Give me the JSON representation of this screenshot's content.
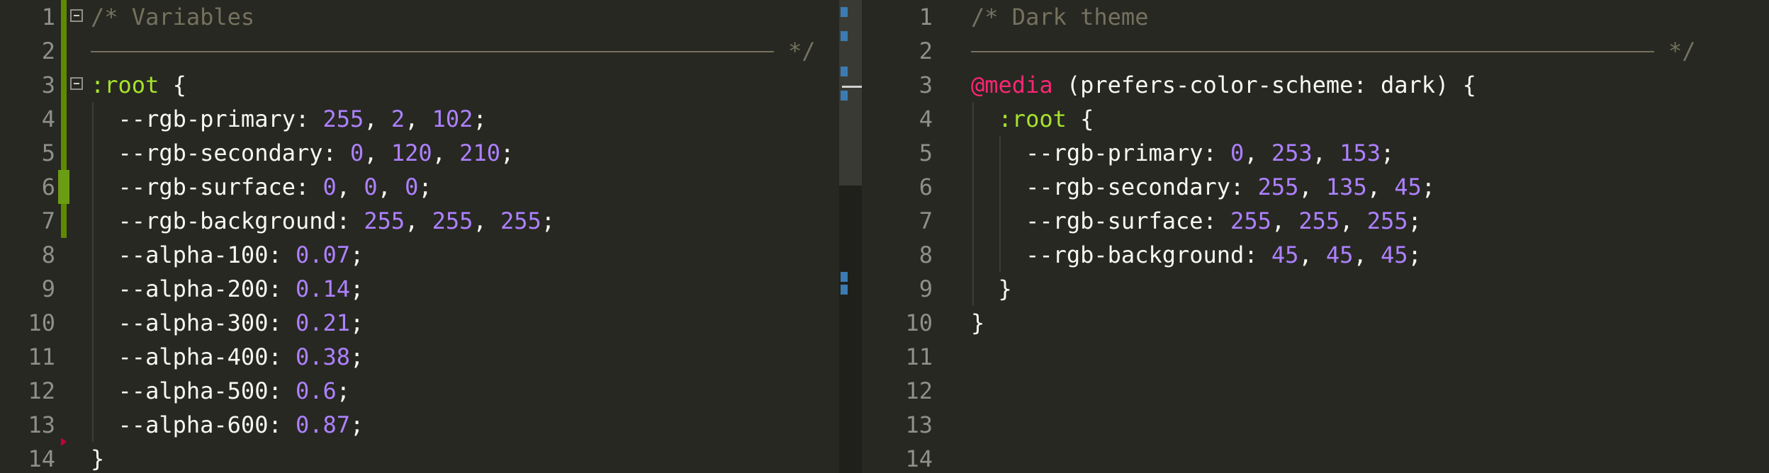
{
  "left_pane": {
    "lines": [
      {
        "n": "1",
        "t": [
          {
            "c": "comment",
            "v": "/* Variables"
          }
        ]
      },
      {
        "n": "2",
        "t": [
          {
            "c": "comment",
            "v": "*/"
          }
        ]
      },
      {
        "n": "3",
        "t": [
          {
            "c": "selector",
            "v": ":root"
          },
          {
            "c": "plain",
            "v": " {"
          }
        ]
      },
      {
        "n": "4",
        "t": [
          {
            "c": "plain",
            "v": "  --rgb-primary: "
          },
          {
            "c": "num",
            "v": "255"
          },
          {
            "c": "plain",
            "v": ", "
          },
          {
            "c": "num",
            "v": "2"
          },
          {
            "c": "plain",
            "v": ", "
          },
          {
            "c": "num",
            "v": "102"
          },
          {
            "c": "plain",
            "v": ";"
          }
        ]
      },
      {
        "n": "5",
        "t": [
          {
            "c": "plain",
            "v": "  --rgb-secondary: "
          },
          {
            "c": "num",
            "v": "0"
          },
          {
            "c": "plain",
            "v": ", "
          },
          {
            "c": "num",
            "v": "120"
          },
          {
            "c": "plain",
            "v": ", "
          },
          {
            "c": "num",
            "v": "210"
          },
          {
            "c": "plain",
            "v": ";"
          }
        ]
      },
      {
        "n": "6",
        "t": [
          {
            "c": "plain",
            "v": "  --rgb-surface: "
          },
          {
            "c": "num",
            "v": "0"
          },
          {
            "c": "plain",
            "v": ", "
          },
          {
            "c": "num",
            "v": "0"
          },
          {
            "c": "plain",
            "v": ", "
          },
          {
            "c": "num",
            "v": "0"
          },
          {
            "c": "plain",
            "v": ";"
          }
        ]
      },
      {
        "n": "7",
        "t": [
          {
            "c": "plain",
            "v": "  --rgb-background: "
          },
          {
            "c": "num",
            "v": "255"
          },
          {
            "c": "plain",
            "v": ", "
          },
          {
            "c": "num",
            "v": "255"
          },
          {
            "c": "plain",
            "v": ", "
          },
          {
            "c": "num",
            "v": "255"
          },
          {
            "c": "plain",
            "v": ";"
          }
        ]
      },
      {
        "n": "8",
        "t": [
          {
            "c": "plain",
            "v": "  --alpha-100: "
          },
          {
            "c": "num",
            "v": "0.07"
          },
          {
            "c": "plain",
            "v": ";"
          }
        ]
      },
      {
        "n": "9",
        "t": [
          {
            "c": "plain",
            "v": "  --alpha-200: "
          },
          {
            "c": "num",
            "v": "0.14"
          },
          {
            "c": "plain",
            "v": ";"
          }
        ]
      },
      {
        "n": "10",
        "t": [
          {
            "c": "plain",
            "v": "  --alpha-300: "
          },
          {
            "c": "num",
            "v": "0.21"
          },
          {
            "c": "plain",
            "v": ";"
          }
        ]
      },
      {
        "n": "11",
        "t": [
          {
            "c": "plain",
            "v": "  --alpha-400: "
          },
          {
            "c": "num",
            "v": "0.38"
          },
          {
            "c": "plain",
            "v": ";"
          }
        ]
      },
      {
        "n": "12",
        "t": [
          {
            "c": "plain",
            "v": "  --alpha-500: "
          },
          {
            "c": "num",
            "v": "0.6"
          },
          {
            "c": "plain",
            "v": ";"
          }
        ]
      },
      {
        "n": "13",
        "t": [
          {
            "c": "plain",
            "v": "  --alpha-600: "
          },
          {
            "c": "num",
            "v": "0.87"
          },
          {
            "c": "plain",
            "v": ";"
          }
        ]
      },
      {
        "n": "14",
        "t": [
          {
            "c": "plain",
            "v": "}"
          }
        ]
      }
    ]
  },
  "right_pane": {
    "lines": [
      {
        "n": "1",
        "t": [
          {
            "c": "comment",
            "v": "/* Dark theme"
          }
        ]
      },
      {
        "n": "2",
        "t": [
          {
            "c": "comment",
            "v": "*/"
          }
        ]
      },
      {
        "n": "3",
        "t": [
          {
            "c": "atrule",
            "v": "@media"
          },
          {
            "c": "plain",
            "v": " (prefers-color-scheme: dark) {"
          }
        ]
      },
      {
        "n": "4",
        "t": [
          {
            "c": "selector",
            "v": "  :root"
          },
          {
            "c": "plain",
            "v": " {"
          }
        ]
      },
      {
        "n": "5",
        "t": [
          {
            "c": "plain",
            "v": "    --rgb-primary: "
          },
          {
            "c": "num",
            "v": "0"
          },
          {
            "c": "plain",
            "v": ", "
          },
          {
            "c": "num",
            "v": "253"
          },
          {
            "c": "plain",
            "v": ", "
          },
          {
            "c": "num",
            "v": "153"
          },
          {
            "c": "plain",
            "v": ";"
          }
        ]
      },
      {
        "n": "6",
        "t": [
          {
            "c": "plain",
            "v": "    --rgb-secondary: "
          },
          {
            "c": "num",
            "v": "255"
          },
          {
            "c": "plain",
            "v": ", "
          },
          {
            "c": "num",
            "v": "135"
          },
          {
            "c": "plain",
            "v": ", "
          },
          {
            "c": "num",
            "v": "45"
          },
          {
            "c": "plain",
            "v": ";"
          }
        ]
      },
      {
        "n": "7",
        "t": [
          {
            "c": "plain",
            "v": "    --rgb-surface: "
          },
          {
            "c": "num",
            "v": "255"
          },
          {
            "c": "plain",
            "v": ", "
          },
          {
            "c": "num",
            "v": "255"
          },
          {
            "c": "plain",
            "v": ", "
          },
          {
            "c": "num",
            "v": "255"
          },
          {
            "c": "plain",
            "v": ";"
          }
        ]
      },
      {
        "n": "8",
        "t": [
          {
            "c": "plain",
            "v": "    --rgb-background: "
          },
          {
            "c": "num",
            "v": "45"
          },
          {
            "c": "plain",
            "v": ", "
          },
          {
            "c": "num",
            "v": "45"
          },
          {
            "c": "plain",
            "v": ", "
          },
          {
            "c": "num",
            "v": "45"
          },
          {
            "c": "plain",
            "v": ";"
          }
        ]
      },
      {
        "n": "9",
        "t": [
          {
            "c": "plain",
            "v": "  }"
          }
        ]
      },
      {
        "n": "10",
        "t": [
          {
            "c": "plain",
            "v": "}"
          }
        ]
      },
      {
        "n": "11",
        "t": []
      },
      {
        "n": "12",
        "t": []
      },
      {
        "n": "13",
        "t": []
      },
      {
        "n": "14",
        "t": []
      }
    ]
  },
  "colors": {
    "background": "#272822",
    "comment": "#75715e",
    "number": "#ae81ff",
    "selector": "#a6e22e",
    "at_rule": "#f92672",
    "text": "#f8f8f2",
    "line_number": "#90908a",
    "git_modified": "#5f8a00"
  },
  "icons": [
    "fold-icon",
    "git-change-marker-icon",
    "error-marker-icon"
  ]
}
